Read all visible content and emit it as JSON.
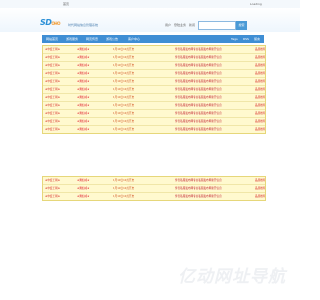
{
  "topbar": {
    "home": "首页",
    "status": "Loading"
  },
  "header": {
    "logo": "SD",
    "logo_sub": "OHO",
    "site_name": "时代网站信息管理系统",
    "user_links": [
      "用户",
      "登陆业务",
      "新闻",
      "后台"
    ],
    "search_placeholder": "",
    "search_button": "搜索"
  },
  "nav": {
    "items": [
      "网站首页",
      "游戏服务",
      "网页传奇",
      "游戏公告",
      "客户中心",
      "Tags",
      "RSS",
      "留言"
    ]
  },
  "panel1": {
    "rows": [
      [
        "★中变王朝★",
        "★鹰仙域★",
        "1月19日10点开启",
        "传奇私服发布网专业私服发布网新开信息",
        "品质推荐"
      ],
      [
        "★中变王朝★",
        "★鹰仙域★",
        "1月19日10点开启",
        "传奇私服发布网专业私服发布网新开信息",
        "品质推荐"
      ],
      [
        "★中变王朝★",
        "★鹰仙域★",
        "1月19日10点开启",
        "传奇私服发布网专业私服发布网新开信息",
        "品质推荐"
      ],
      [
        "★中变王朝★",
        "★鹰仙域★",
        "1月19日10点开启",
        "传奇私服发布网专业私服发布网新开信息",
        "品质推荐"
      ],
      [
        "★中变王朝★",
        "★鹰仙域★",
        "1月19日10点开启",
        "传奇私服发布网专业私服发布网新开信息",
        "品质推荐"
      ],
      [
        "★中变王朝★",
        "★鹰仙域★",
        "1月19日10点开启",
        "传奇私服发布网专业私服发布网新开信息",
        "品质推荐"
      ],
      [
        "★中变王朝★",
        "★鹰仙域★",
        "1月19日10点开启",
        "传奇私服发布网专业私服发布网新开信息",
        "品质推荐"
      ],
      [
        "★中变王朝★",
        "★鹰仙域★",
        "1月19日10点开启",
        "传奇私服发布网专业私服发布网新开信息",
        "品质推荐"
      ],
      [
        "★中变王朝★",
        "★鹰仙域★",
        "1月19日10点开启",
        "传奇私服发布网专业私服发布网新开信息",
        "品质推荐"
      ],
      [
        "★中变王朝★",
        "★鹰仙域★",
        "1月19日10点开启",
        "传奇私服发布网专业私服发布网新开信息",
        "品质推荐"
      ],
      [
        "★中变王朝★",
        "★鹰仙域★",
        "1月19日10点开启",
        "传奇私服发布网专业私服发布网新开信息",
        "品质推荐"
      ]
    ]
  },
  "panel2": {
    "rows": [
      [
        "★中变王朝★",
        "★鹰仙域★",
        "1月19日10点开启",
        "传奇私服发布网专业私服发布网新开信息",
        "品质推荐"
      ],
      [
        "★中变王朝★",
        "★鹰仙域★",
        "1月19日10点开启",
        "传奇私服发布网专业私服发布网新开信息",
        "品质推荐"
      ],
      [
        "★中变王朝★",
        "★鹰仙域★",
        "1月19日10点开启",
        "传奇私服发布网专业私服发布网新开信息",
        "品质推荐"
      ]
    ]
  },
  "watermark": "亿动网址导航"
}
